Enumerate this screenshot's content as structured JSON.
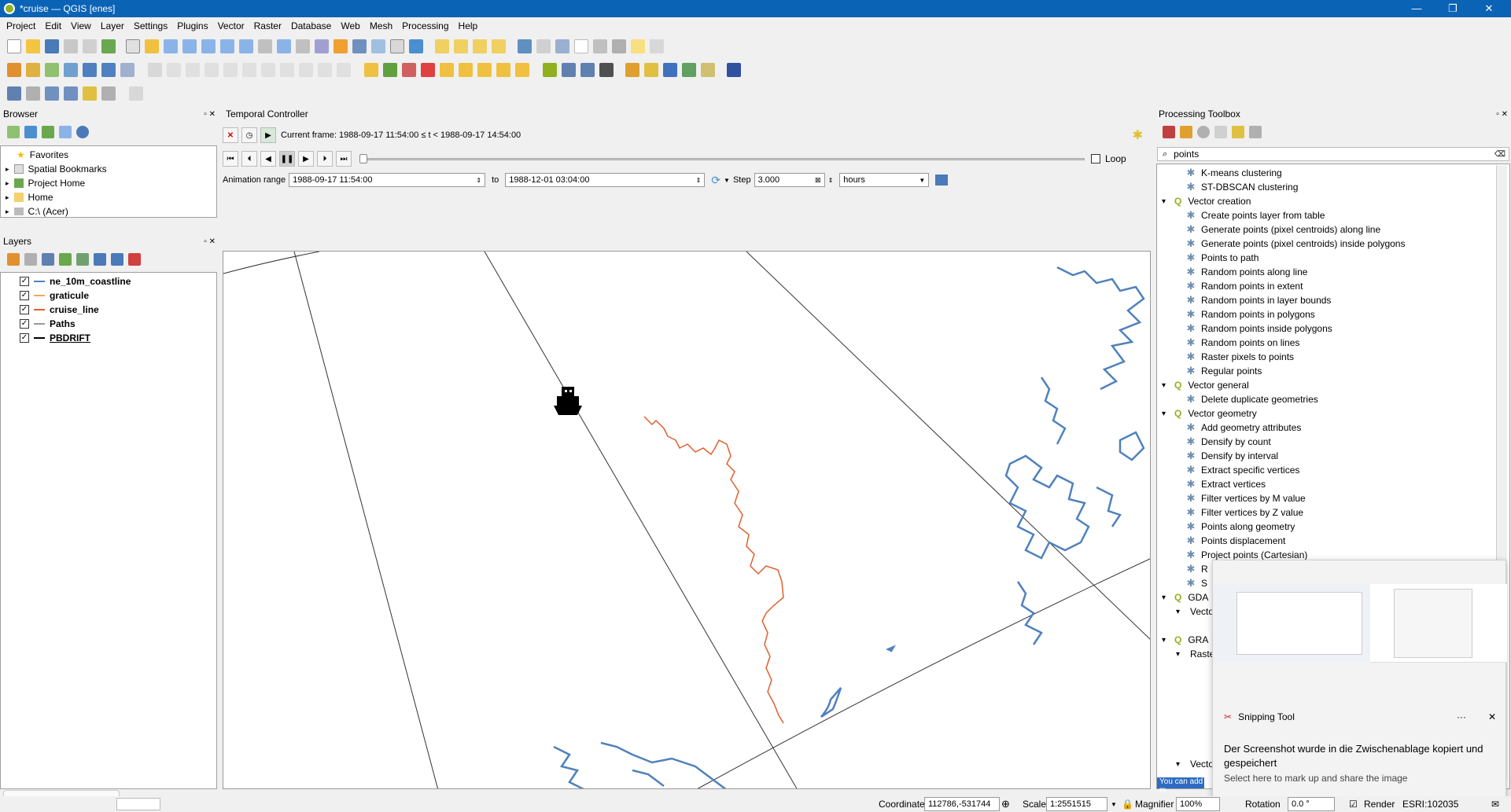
{
  "window": {
    "title": "*cruise — QGIS [enes]",
    "controls": [
      "—",
      "❐",
      "✕"
    ]
  },
  "menu": [
    "Project",
    "Edit",
    "View",
    "Layer",
    "Settings",
    "Plugins",
    "Vector",
    "Raster",
    "Database",
    "Web",
    "Mesh",
    "Processing",
    "Help"
  ],
  "browser": {
    "title": "Browser",
    "items": [
      "Favorites",
      "Spatial Bookmarks",
      "Project Home",
      "Home",
      "C:\\ (Acer)"
    ]
  },
  "layers": {
    "title": "Layers",
    "items": [
      {
        "name": "ne_10m_coastline",
        "checked": true,
        "swatch": "#4f81bd"
      },
      {
        "name": "graticule",
        "checked": true,
        "swatch": "#e8a860"
      },
      {
        "name": "cruise_line",
        "checked": true,
        "swatch": "#e06030"
      },
      {
        "name": "Paths",
        "checked": true,
        "swatch": "#999999"
      },
      {
        "name": "PBDRIFT",
        "checked": true,
        "swatch": "#000000"
      }
    ]
  },
  "temporal": {
    "title": "Temporal Controller",
    "current_frame": "Current frame: 1988-09-17 11:54:00 ≤ t < 1988-09-17 14:54:00",
    "loop_label": "Loop",
    "range_label": "Animation range",
    "range_start": "1988-09-17 11:54:00",
    "to_label": "to",
    "range_end": "1988-12-01 03:04:00",
    "step_label": "Step",
    "step_value": "3.000",
    "step_unit": "hours",
    "progress": 0.0
  },
  "toolbox": {
    "title": "Processing Toolbox",
    "search_value": "points",
    "rows": [
      {
        "type": "item",
        "label": "K-means clustering"
      },
      {
        "type": "item",
        "label": "ST-DBSCAN clustering"
      },
      {
        "type": "group",
        "label": "Vector creation"
      },
      {
        "type": "item",
        "label": "Create points layer from table"
      },
      {
        "type": "item",
        "label": "Generate points (pixel centroids) along line"
      },
      {
        "type": "item",
        "label": "Generate points (pixel centroids) inside polygons"
      },
      {
        "type": "item",
        "label": "Points to path"
      },
      {
        "type": "item",
        "label": "Random points along line"
      },
      {
        "type": "item",
        "label": "Random points in extent"
      },
      {
        "type": "item",
        "label": "Random points in layer bounds"
      },
      {
        "type": "item",
        "label": "Random points in polygons"
      },
      {
        "type": "item",
        "label": "Random points inside polygons"
      },
      {
        "type": "item",
        "label": "Random points on lines"
      },
      {
        "type": "item",
        "label": "Raster pixels to points"
      },
      {
        "type": "item",
        "label": "Regular points"
      },
      {
        "type": "group",
        "label": "Vector general"
      },
      {
        "type": "item",
        "label": "Delete duplicate geometries"
      },
      {
        "type": "group",
        "label": "Vector geometry"
      },
      {
        "type": "item",
        "label": "Add geometry attributes"
      },
      {
        "type": "item",
        "label": "Densify by count"
      },
      {
        "type": "item",
        "label": "Densify by interval"
      },
      {
        "type": "item",
        "label": "Extract specific vertices"
      },
      {
        "type": "item",
        "label": "Extract vertices"
      },
      {
        "type": "item",
        "label": "Filter vertices by M value"
      },
      {
        "type": "item",
        "label": "Filter vertices by Z value"
      },
      {
        "type": "item",
        "label": "Points along geometry"
      },
      {
        "type": "item",
        "label": "Points displacement"
      },
      {
        "type": "item",
        "label": "Project points (Cartesian)"
      },
      {
        "type": "item",
        "label": "R"
      },
      {
        "type": "item",
        "label": "S"
      },
      {
        "type": "group2",
        "label": "GDA"
      },
      {
        "type": "sub",
        "label": "Vecto"
      },
      {
        "type": "blank",
        "label": ""
      },
      {
        "type": "group2",
        "label": "GRA"
      },
      {
        "type": "sub",
        "label": "Raster"
      }
    ],
    "bottom_sub": "Vecto",
    "hint": "You can add m"
  },
  "snip": {
    "app": "Snipping Tool",
    "more": "···",
    "message": "Der Screenshot wurde in die Zwischenablage kopiert und gespeichert",
    "sub": "Select here to mark up and share the image"
  },
  "status": {
    "coordinate_label": "Coordinate",
    "coordinate_value": "112786,-531744",
    "scale_label": "Scale",
    "scale_value": "1:2551515",
    "magnifier_label": "Magnifier",
    "magnifier_value": "100%",
    "rotation_label": "Rotation",
    "rotation_value": "0.0 °",
    "render_label": "Render",
    "crs_label": "ESRI:102035"
  },
  "colors": {
    "accent": "#0b63b6",
    "coastline": "#4f81bd",
    "cruise": "#e06030"
  }
}
